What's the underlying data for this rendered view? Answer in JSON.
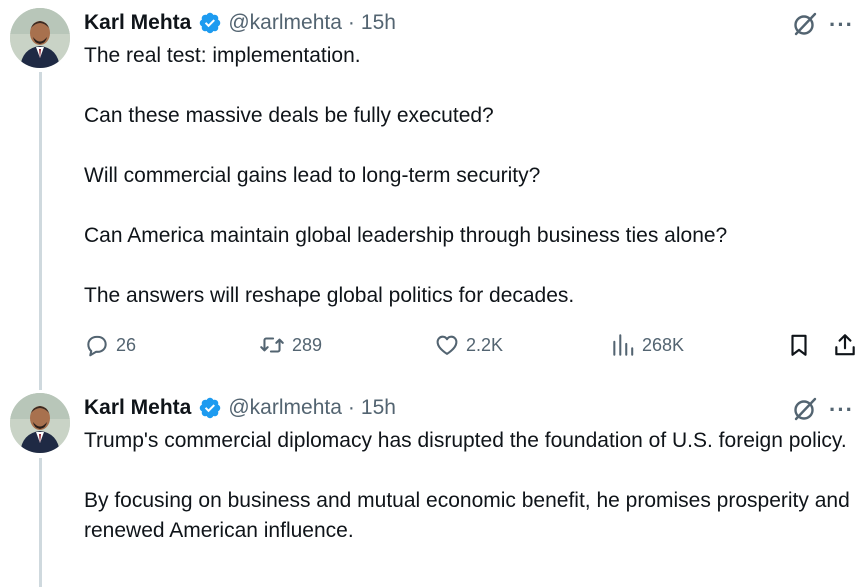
{
  "colors": {
    "text": "#0f1419",
    "secondary": "#536471",
    "verified": "#1d9bf0",
    "thread_line": "#cfd9de"
  },
  "tweets": [
    {
      "author": "Karl Mehta",
      "handle": "@karlmehta",
      "separator": "·",
      "time": "15h",
      "verified_icon": "verified-badge-icon",
      "paragraphs": [
        "The real test: implementation.",
        "Can these massive deals be fully executed?",
        "Will commercial gains lead to long-term security?",
        "Can America maintain global leadership through business ties alone?",
        "The answers will reshape global politics for decades."
      ],
      "actions": {
        "replies": "26",
        "reposts": "289",
        "likes": "2.2K",
        "views": "268K"
      }
    },
    {
      "author": "Karl Mehta",
      "handle": "@karlmehta",
      "separator": "·",
      "time": "15h",
      "verified_icon": "verified-badge-icon",
      "paragraphs": [
        "Trump's commercial diplomacy has disrupted the foundation of U.S. foreign policy.",
        "By focusing on business and mutual economic benefit, he promises prosperity and renewed American influence."
      ]
    }
  ],
  "more_label": "···"
}
